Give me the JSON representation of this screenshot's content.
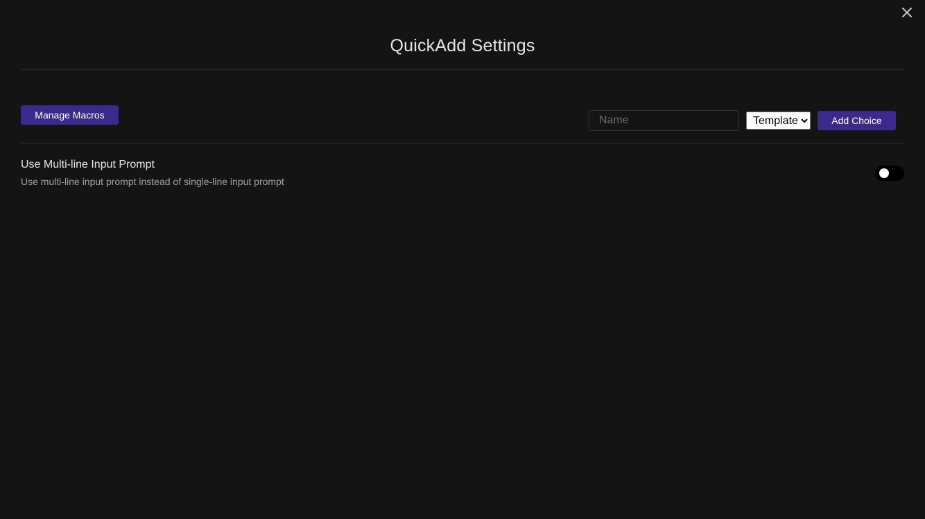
{
  "modal": {
    "title": "QuickAdd Settings",
    "close_icon": "close-icon"
  },
  "toolbar": {
    "manage_macros_label": "Manage Macros",
    "name_placeholder": "Name",
    "name_value": "",
    "choice_type_selected": "Template",
    "add_choice_label": "Add Choice"
  },
  "settings": {
    "multiline": {
      "name": "Use Multi-line Input Prompt",
      "description": "Use multi-line input prompt instead of single-line input prompt",
      "enabled": false
    }
  },
  "colors": {
    "background": "#141414",
    "accent": "#3b2a8c",
    "divider": "#2a2a2a"
  }
}
